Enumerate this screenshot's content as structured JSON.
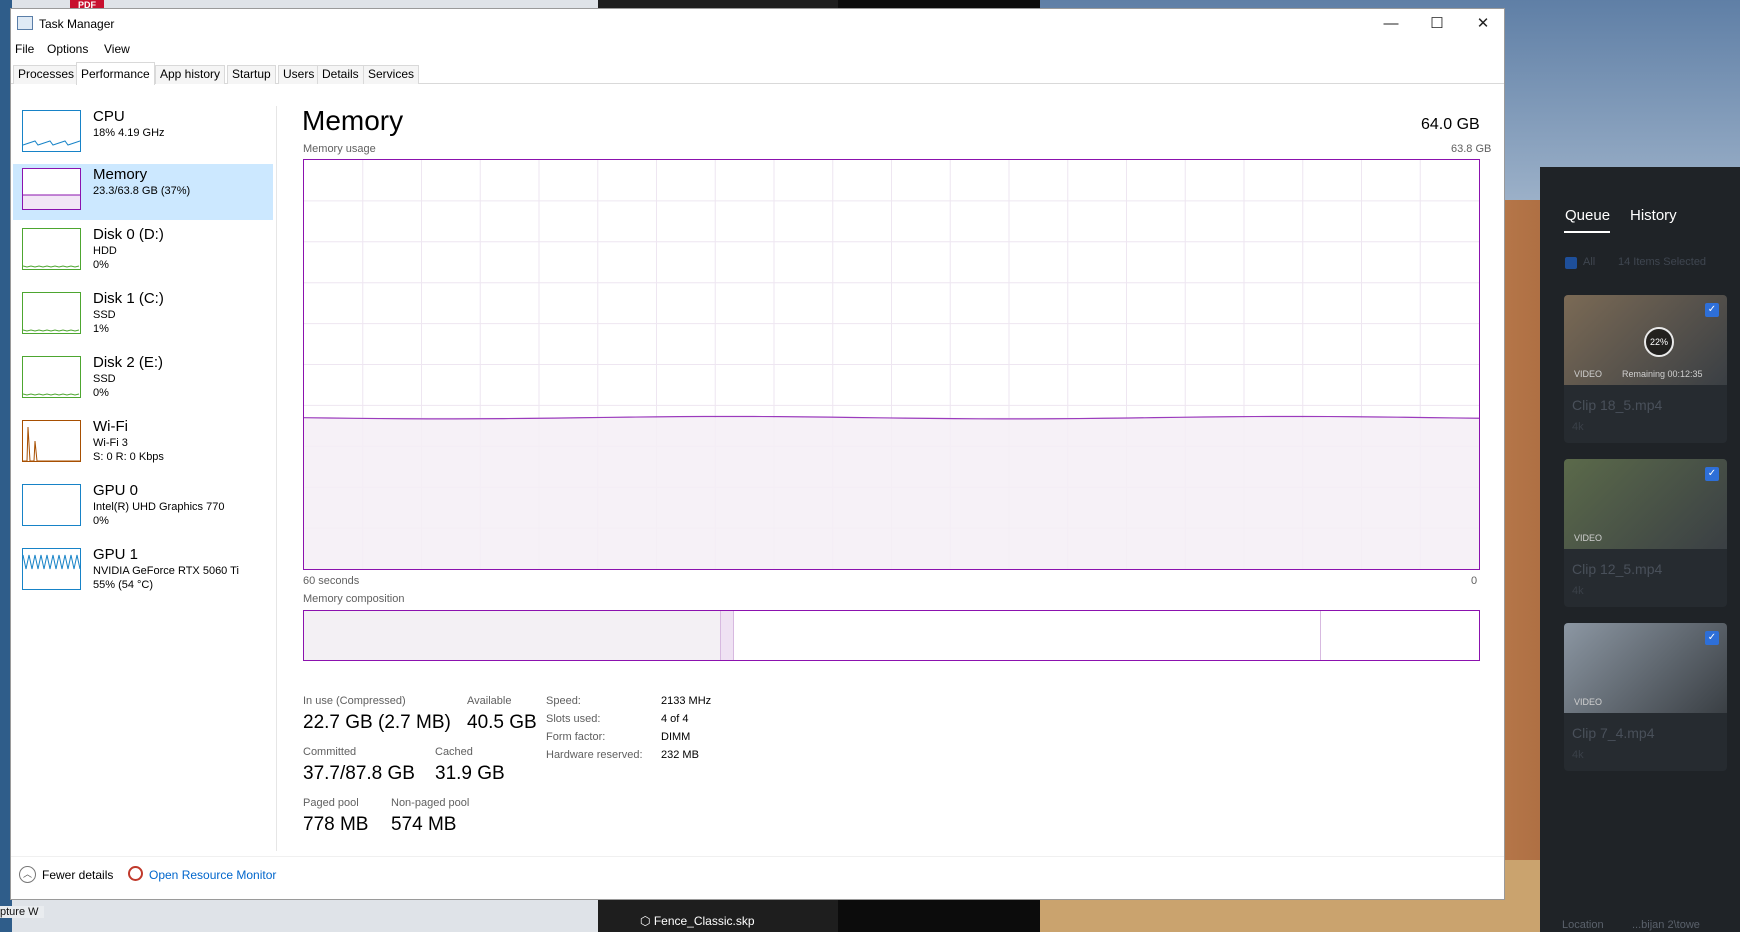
{
  "desktop": {
    "pdf_badge": "PDF",
    "left_label": "pture W",
    "taskbar_file": "Fence_Classic.skp"
  },
  "right_panel": {
    "tabs": [
      "Queue",
      "History"
    ],
    "filter_all": "All",
    "selected_count": "14 Items Selected",
    "cards": [
      {
        "name": "Clip 18_5.mp4",
        "res": "4k",
        "type": "VIDEO",
        "progress": "22%",
        "remaining": "Remaining 00:12:35",
        "thumb_color": "#7b6a55"
      },
      {
        "name": "Clip 12_5.mp4",
        "res": "4k",
        "type": "VIDEO",
        "thumb_color": "#5b6a4a"
      },
      {
        "name": "Clip 7_4.mp4",
        "res": "4k",
        "type": "VIDEO",
        "thumb_color": "#8c97a3"
      }
    ],
    "location_label": "Location",
    "location_value": "...bijan 2\\towe"
  },
  "window": {
    "title": "Task Manager",
    "controls": {
      "minimize": "—",
      "maximize": "☐",
      "close": "✕"
    }
  },
  "menu": [
    "File",
    "Options",
    "View"
  ],
  "tabs": [
    "Processes",
    "Performance",
    "App history",
    "Startup",
    "Users",
    "Details",
    "Services"
  ],
  "active_tab": "Performance",
  "sidebar": [
    {
      "title": "CPU",
      "line1": "18%  4.19 GHz",
      "line2": "",
      "color": "#1783c7"
    },
    {
      "title": "Memory",
      "line1": "23.3/63.8 GB (37%)",
      "line2": "",
      "color": "#8b12ae"
    },
    {
      "title": "Disk 0 (D:)",
      "line1": "HDD",
      "line2": "0%",
      "color": "#4da630"
    },
    {
      "title": "Disk 1 (C:)",
      "line1": "SSD",
      "line2": "1%",
      "color": "#4da630"
    },
    {
      "title": "Disk 2 (E:)",
      "line1": "SSD",
      "line2": "0%",
      "color": "#4da630"
    },
    {
      "title": "Wi-Fi",
      "line1": "Wi-Fi 3",
      "line2": "S: 0  R: 0 Kbps",
      "color": "#a74f01"
    },
    {
      "title": "GPU 0",
      "line1": "Intel(R) UHD Graphics 770",
      "line2": "0%",
      "color": "#1783c7"
    },
    {
      "title": "GPU 1",
      "line1": "NVIDIA GeForce RTX 5060 Ti",
      "line2": "55%  (54 °C)",
      "color": "#1783c7"
    }
  ],
  "main": {
    "title": "Memory",
    "total": "64.0 GB",
    "usage_label": "Memory usage",
    "usage_max": "63.8 GB",
    "x_left": "60 seconds",
    "x_right": "0",
    "composition_label": "Memory composition",
    "composition": {
      "in_use": 22.7,
      "modified": 0.7,
      "standby": 31.9,
      "free": 8.6
    },
    "usage_fraction": 0.37,
    "stats": {
      "in_use_label": "In use (Compressed)",
      "in_use_value": "22.7 GB (2.7 MB)",
      "available_label": "Available",
      "available_value": "40.5 GB",
      "committed_label": "Committed",
      "committed_value": "37.7/87.8 GB",
      "cached_label": "Cached",
      "cached_value": "31.9 GB",
      "paged_label": "Paged pool",
      "paged_value": "778 MB",
      "nonpaged_label": "Non-paged pool",
      "nonpaged_value": "574 MB"
    },
    "specs": {
      "speed_label": "Speed:",
      "speed_value": "2133 MHz",
      "slots_label": "Slots used:",
      "slots_value": "4 of 4",
      "form_label": "Form factor:",
      "form_value": "DIMM",
      "reserved_label": "Hardware reserved:",
      "reserved_value": "232 MB"
    }
  },
  "footer": {
    "fewer_details": "Fewer details",
    "open_resource_monitor": "Open Resource Monitor"
  }
}
